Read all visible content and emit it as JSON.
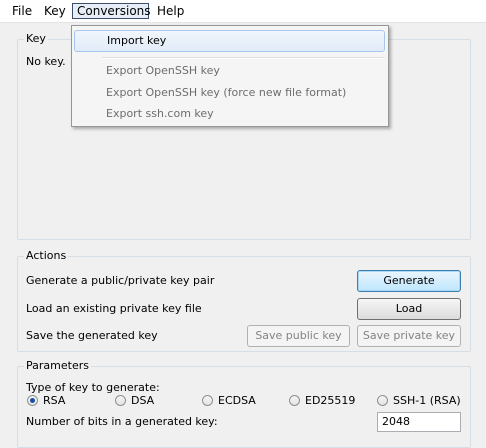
{
  "menubar": {
    "items": [
      "File",
      "Key",
      "Conversions",
      "Help"
    ]
  },
  "dropdown": {
    "items": [
      "Import key",
      "Export OpenSSH key",
      "Export OpenSSH key (force new file format)",
      "Export ssh.com key"
    ]
  },
  "key_group": {
    "title": "Key",
    "status": "No key."
  },
  "actions": {
    "title": "Actions",
    "generate_label": "Generate a public/private key pair",
    "generate_button": "Generate",
    "load_label": "Load an existing private key file",
    "load_button": "Load",
    "save_label": "Save the generated key",
    "save_public_button": "Save public key",
    "save_private_button": "Save private key"
  },
  "parameters": {
    "title": "Parameters",
    "type_label": "Type of key to generate:",
    "key_types": [
      "RSA",
      "DSA",
      "ECDSA",
      "ED25519",
      "SSH-1 (RSA)"
    ],
    "selected_type": "RSA",
    "bits_label": "Number of bits in a generated key:",
    "bits_value": "2048"
  }
}
